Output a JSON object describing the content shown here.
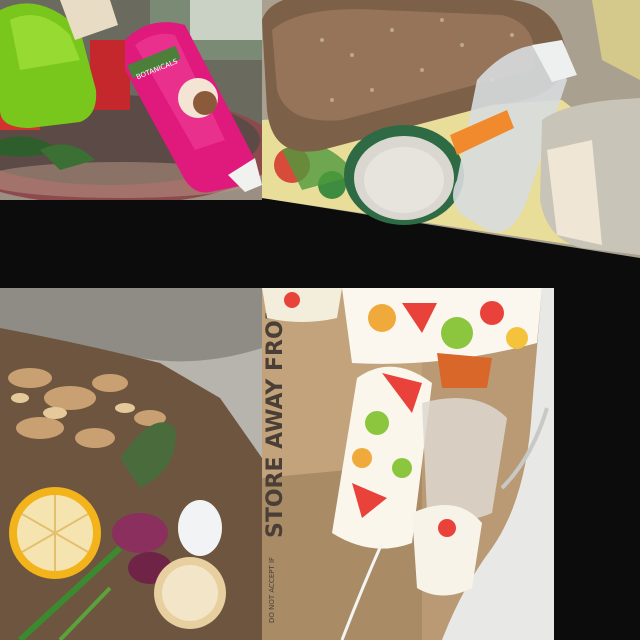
{
  "tiles": {
    "top_left": {
      "shampoo_label": "BOTANICALS"
    },
    "top_right": {},
    "bottom_left": {},
    "bottom_right": {
      "box_print": "STORE AWAY FROM",
      "box_small_print": "DO NOT ACCEPT IF"
    }
  }
}
